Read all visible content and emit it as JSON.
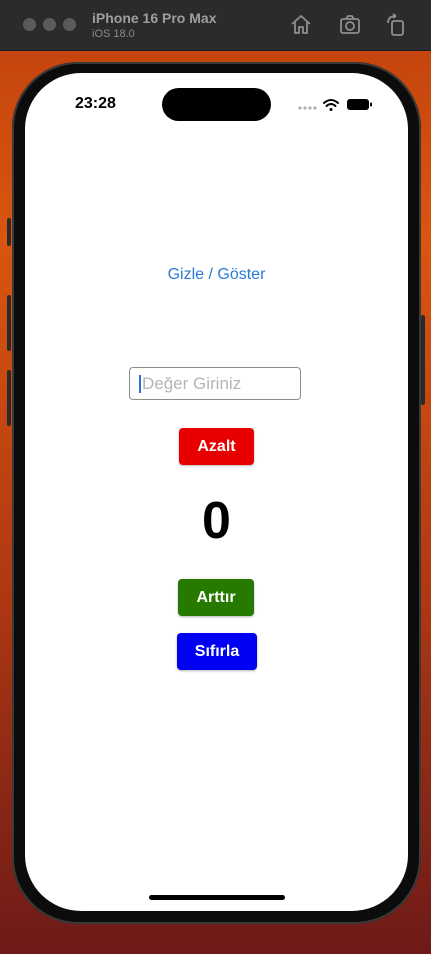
{
  "simulator": {
    "device_name": "iPhone 16 Pro Max",
    "os_version": "iOS 18.0",
    "toolbar_icons": [
      "home-icon",
      "screenshot-icon",
      "rotate-icon"
    ]
  },
  "status_bar": {
    "time": "23:28",
    "icons": [
      "signal-dots-icon",
      "wifi-icon",
      "battery-icon"
    ]
  },
  "app": {
    "toggle_label": "Gizle / Göster",
    "input_placeholder": "Değer Giriniz",
    "input_value": "",
    "decrement_label": "Azalt",
    "counter_value": "0",
    "increment_label": "Arttır",
    "reset_label": "Sıfırla"
  },
  "colors": {
    "link": "#2a7ad8",
    "decrement": "#e80000",
    "increment": "#267a00",
    "reset": "#0000f2"
  }
}
